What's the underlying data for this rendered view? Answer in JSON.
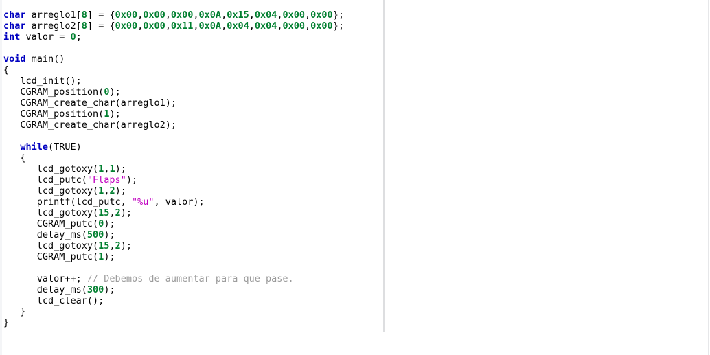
{
  "editor": {
    "language": "c",
    "background_color": "#ffffff",
    "margin_guide_color": "#dddee0",
    "token_colors": {
      "keyword": "#0000c0",
      "number": "#007f2f",
      "string": "#c000c0",
      "comment": "#9b9b9b",
      "plain": "#000000"
    },
    "lines": [
      {
        "n": 1,
        "tokens": [
          {
            "t": "keyword",
            "v": "char"
          },
          {
            "t": "plain",
            "v": " arreglo1["
          },
          {
            "t": "number",
            "v": "8"
          },
          {
            "t": "plain",
            "v": "] = {"
          },
          {
            "t": "number",
            "v": "0x00"
          },
          {
            "t": "plain",
            "v": ","
          },
          {
            "t": "number",
            "v": "0x00"
          },
          {
            "t": "plain",
            "v": ","
          },
          {
            "t": "number",
            "v": "0x00"
          },
          {
            "t": "plain",
            "v": ","
          },
          {
            "t": "number",
            "v": "0x0A"
          },
          {
            "t": "plain",
            "v": ","
          },
          {
            "t": "number",
            "v": "0x15"
          },
          {
            "t": "plain",
            "v": ","
          },
          {
            "t": "number",
            "v": "0x04"
          },
          {
            "t": "plain",
            "v": ","
          },
          {
            "t": "number",
            "v": "0x00"
          },
          {
            "t": "plain",
            "v": ","
          },
          {
            "t": "number",
            "v": "0x00"
          },
          {
            "t": "plain",
            "v": "};"
          }
        ]
      },
      {
        "n": 2,
        "tokens": [
          {
            "t": "keyword",
            "v": "char"
          },
          {
            "t": "plain",
            "v": " arreglo2["
          },
          {
            "t": "number",
            "v": "8"
          },
          {
            "t": "plain",
            "v": "] = {"
          },
          {
            "t": "number",
            "v": "0x00"
          },
          {
            "t": "plain",
            "v": ","
          },
          {
            "t": "number",
            "v": "0x00"
          },
          {
            "t": "plain",
            "v": ","
          },
          {
            "t": "number",
            "v": "0x11"
          },
          {
            "t": "plain",
            "v": ","
          },
          {
            "t": "number",
            "v": "0x0A"
          },
          {
            "t": "plain",
            "v": ","
          },
          {
            "t": "number",
            "v": "0x04"
          },
          {
            "t": "plain",
            "v": ","
          },
          {
            "t": "number",
            "v": "0x04"
          },
          {
            "t": "plain",
            "v": ","
          },
          {
            "t": "number",
            "v": "0x00"
          },
          {
            "t": "plain",
            "v": ","
          },
          {
            "t": "number",
            "v": "0x00"
          },
          {
            "t": "plain",
            "v": "};"
          }
        ]
      },
      {
        "n": 3,
        "tokens": [
          {
            "t": "keyword",
            "v": "int"
          },
          {
            "t": "plain",
            "v": " valor = "
          },
          {
            "t": "number",
            "v": "0"
          },
          {
            "t": "plain",
            "v": ";"
          }
        ]
      },
      {
        "n": 4,
        "tokens": []
      },
      {
        "n": 5,
        "tokens": [
          {
            "t": "keyword",
            "v": "void"
          },
          {
            "t": "plain",
            "v": " main()"
          }
        ]
      },
      {
        "n": 6,
        "tokens": [
          {
            "t": "plain",
            "v": "{"
          }
        ]
      },
      {
        "n": 7,
        "tokens": [
          {
            "t": "plain",
            "v": "   lcd_init();"
          }
        ]
      },
      {
        "n": 8,
        "tokens": [
          {
            "t": "plain",
            "v": "   CGRAM_position("
          },
          {
            "t": "number",
            "v": "0"
          },
          {
            "t": "plain",
            "v": ");"
          }
        ]
      },
      {
        "n": 9,
        "tokens": [
          {
            "t": "plain",
            "v": "   CGRAM_create_char(arreglo1);"
          }
        ]
      },
      {
        "n": 10,
        "tokens": [
          {
            "t": "plain",
            "v": "   CGRAM_position("
          },
          {
            "t": "number",
            "v": "1"
          },
          {
            "t": "plain",
            "v": ");"
          }
        ]
      },
      {
        "n": 11,
        "tokens": [
          {
            "t": "plain",
            "v": "   CGRAM_create_char(arreglo2);"
          }
        ]
      },
      {
        "n": 12,
        "tokens": []
      },
      {
        "n": 13,
        "tokens": [
          {
            "t": "plain",
            "v": "   "
          },
          {
            "t": "keyword",
            "v": "while"
          },
          {
            "t": "plain",
            "v": "(TRUE)"
          }
        ]
      },
      {
        "n": 14,
        "tokens": [
          {
            "t": "plain",
            "v": "   {"
          }
        ]
      },
      {
        "n": 15,
        "tokens": [
          {
            "t": "plain",
            "v": "      lcd_gotoxy("
          },
          {
            "t": "number",
            "v": "1"
          },
          {
            "t": "plain",
            "v": ","
          },
          {
            "t": "number",
            "v": "1"
          },
          {
            "t": "plain",
            "v": ");"
          }
        ]
      },
      {
        "n": 16,
        "tokens": [
          {
            "t": "plain",
            "v": "      lcd_putc("
          },
          {
            "t": "string",
            "v": "\"Flaps\""
          },
          {
            "t": "plain",
            "v": ");"
          }
        ]
      },
      {
        "n": 17,
        "tokens": [
          {
            "t": "plain",
            "v": "      lcd_gotoxy("
          },
          {
            "t": "number",
            "v": "1"
          },
          {
            "t": "plain",
            "v": ","
          },
          {
            "t": "number",
            "v": "2"
          },
          {
            "t": "plain",
            "v": ");"
          }
        ]
      },
      {
        "n": 18,
        "tokens": [
          {
            "t": "plain",
            "v": "      printf(lcd_putc, "
          },
          {
            "t": "string",
            "v": "\"%u\""
          },
          {
            "t": "plain",
            "v": ", valor);"
          }
        ]
      },
      {
        "n": 19,
        "tokens": [
          {
            "t": "plain",
            "v": "      lcd_gotoxy("
          },
          {
            "t": "number",
            "v": "15"
          },
          {
            "t": "plain",
            "v": ","
          },
          {
            "t": "number",
            "v": "2"
          },
          {
            "t": "plain",
            "v": ");"
          }
        ]
      },
      {
        "n": 20,
        "tokens": [
          {
            "t": "plain",
            "v": "      CGRAM_putc("
          },
          {
            "t": "number",
            "v": "0"
          },
          {
            "t": "plain",
            "v": ");"
          }
        ]
      },
      {
        "n": 21,
        "tokens": [
          {
            "t": "plain",
            "v": "      delay_ms("
          },
          {
            "t": "number",
            "v": "500"
          },
          {
            "t": "plain",
            "v": ");"
          }
        ]
      },
      {
        "n": 22,
        "tokens": [
          {
            "t": "plain",
            "v": "      lcd_gotoxy("
          },
          {
            "t": "number",
            "v": "15"
          },
          {
            "t": "plain",
            "v": ","
          },
          {
            "t": "number",
            "v": "2"
          },
          {
            "t": "plain",
            "v": ");"
          }
        ]
      },
      {
        "n": 23,
        "tokens": [
          {
            "t": "plain",
            "v": "      CGRAM_putc("
          },
          {
            "t": "number",
            "v": "1"
          },
          {
            "t": "plain",
            "v": ");"
          }
        ]
      },
      {
        "n": 24,
        "tokens": []
      },
      {
        "n": 25,
        "tokens": [
          {
            "t": "plain",
            "v": "      valor++; "
          },
          {
            "t": "comment",
            "v": "// Debemos de aumentar para que pase."
          }
        ]
      },
      {
        "n": 26,
        "tokens": [
          {
            "t": "plain",
            "v": "      delay_ms("
          },
          {
            "t": "number",
            "v": "300"
          },
          {
            "t": "plain",
            "v": ");"
          }
        ]
      },
      {
        "n": 27,
        "tokens": [
          {
            "t": "plain",
            "v": "      lcd_clear();"
          }
        ]
      },
      {
        "n": 28,
        "tokens": [
          {
            "t": "plain",
            "v": "   }"
          }
        ]
      },
      {
        "n": 29,
        "tokens": [
          {
            "t": "plain",
            "v": "}"
          }
        ]
      }
    ]
  }
}
